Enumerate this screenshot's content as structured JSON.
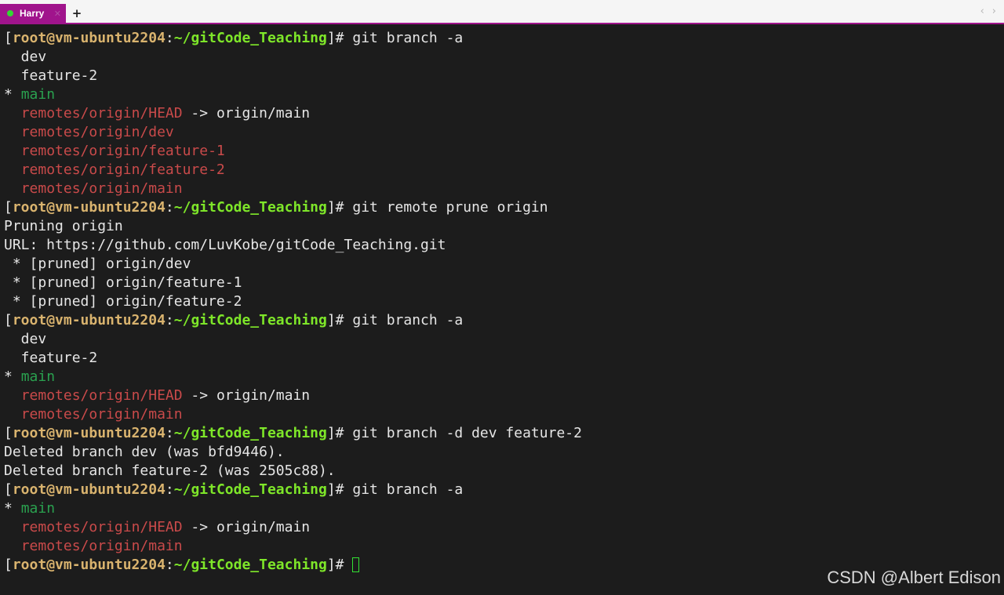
{
  "tabbar": {
    "tab_label": "Harry",
    "tab_close_icon": "x-icon",
    "new_tab_icon": "plus-icon",
    "left_arrow": "‹",
    "right_arrow": "›",
    "accent_color": "#a0148c"
  },
  "prompt": {
    "open": "[",
    "user_host": "root@vm-ubuntu2204",
    "colon": ":",
    "path": "~/gitCode_Teaching",
    "close": "]# "
  },
  "colors": {
    "background": "#1c1c1c",
    "text": "#e6e6e6",
    "prompt_user": "#d9b36e",
    "prompt_path": "#7ee629",
    "current_branch": "#2aa14f",
    "remote_branch": "#c94a4a"
  },
  "lines": [
    {
      "type": "prompt",
      "cmd": "git branch -a"
    },
    {
      "type": "out",
      "text": "  dev"
    },
    {
      "type": "out",
      "text": "  feature-2"
    },
    {
      "type": "current",
      "star": "* ",
      "text": "main"
    },
    {
      "type": "remote",
      "indent": "  ",
      "text": "remotes/origin/HEAD",
      "suffix": " -> origin/main"
    },
    {
      "type": "remote",
      "indent": "  ",
      "text": "remotes/origin/dev",
      "suffix": ""
    },
    {
      "type": "remote",
      "indent": "  ",
      "text": "remotes/origin/feature-1",
      "suffix": ""
    },
    {
      "type": "remote",
      "indent": "  ",
      "text": "remotes/origin/feature-2",
      "suffix": ""
    },
    {
      "type": "remote",
      "indent": "  ",
      "text": "remotes/origin/main",
      "suffix": ""
    },
    {
      "type": "prompt",
      "cmd": "git remote prune origin"
    },
    {
      "type": "out",
      "text": "Pruning origin"
    },
    {
      "type": "out",
      "text": "URL: https://github.com/LuvKobe/gitCode_Teaching.git"
    },
    {
      "type": "out",
      "text": " * [pruned] origin/dev"
    },
    {
      "type": "out",
      "text": " * [pruned] origin/feature-1"
    },
    {
      "type": "out",
      "text": " * [pruned] origin/feature-2"
    },
    {
      "type": "prompt",
      "cmd": "git branch -a"
    },
    {
      "type": "out",
      "text": "  dev"
    },
    {
      "type": "out",
      "text": "  feature-2"
    },
    {
      "type": "current",
      "star": "* ",
      "text": "main"
    },
    {
      "type": "remote",
      "indent": "  ",
      "text": "remotes/origin/HEAD",
      "suffix": " -> origin/main"
    },
    {
      "type": "remote",
      "indent": "  ",
      "text": "remotes/origin/main",
      "suffix": ""
    },
    {
      "type": "prompt",
      "cmd": "git branch -d dev feature-2"
    },
    {
      "type": "out",
      "text": "Deleted branch dev (was bfd9446)."
    },
    {
      "type": "out",
      "text": "Deleted branch feature-2 (was 2505c88)."
    },
    {
      "type": "prompt",
      "cmd": "git branch -a"
    },
    {
      "type": "current",
      "star": "* ",
      "text": "main"
    },
    {
      "type": "remote",
      "indent": "  ",
      "text": "remotes/origin/HEAD",
      "suffix": " -> origin/main"
    },
    {
      "type": "remote",
      "indent": "  ",
      "text": "remotes/origin/main",
      "suffix": ""
    },
    {
      "type": "prompt",
      "cmd": "",
      "cursor": true
    }
  ],
  "watermark": "CSDN @Albert Edison"
}
